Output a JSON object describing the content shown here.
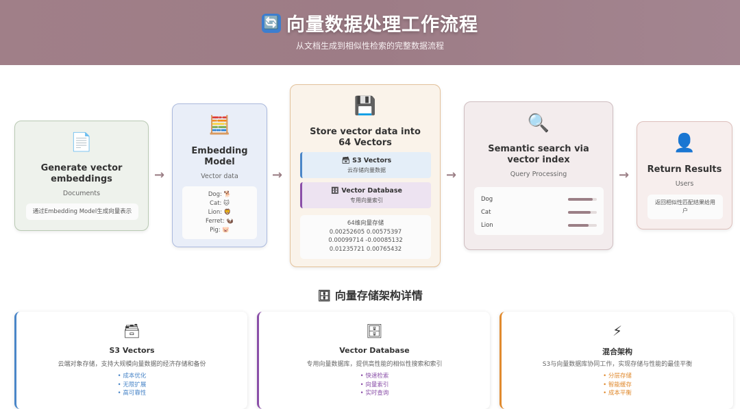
{
  "header": {
    "icon": "🔄",
    "title": "向量数据处理工作流程",
    "subtitle": "从文档生成到相似性检索的完整数据流程"
  },
  "flow": {
    "generate": {
      "icon": "📄",
      "title": "Generate vector embeddings",
      "subtitle": "Documents",
      "note": "通过Embedding Model生成向量表示"
    },
    "embedding": {
      "icon": "🧮",
      "title": "Embedding Model",
      "subtitle": "Vector data",
      "items": [
        "Dog: 🐕",
        "Cat: 🐱",
        "Lion: 🦁",
        "Ferret: 🦦",
        "Pig: 🐷"
      ]
    },
    "store": {
      "icon": "💾",
      "title": "Store vector data into 64 Vectors",
      "s3_title": "🗃 S3 Vectors",
      "s3_sub": "云存储向量数据",
      "db_title": "🗄 Vector Database",
      "db_sub": "专用向量索引",
      "vec_title": "64维向量存储",
      "vec_rows": [
        "0.00252605 0.00575397",
        "0.00099714 -0.00085132",
        "0.01235721 0.00765432"
      ]
    },
    "search": {
      "icon": "🔍",
      "title": "Semantic search via vector index",
      "subtitle": "Query Processing",
      "rows": [
        {
          "label": "Dog",
          "level": 0.85
        },
        {
          "label": "Cat",
          "level": 0.78
        },
        {
          "label": "Lion",
          "level": 0.72
        }
      ]
    },
    "results": {
      "icon": "👤",
      "title": "Return Results",
      "subtitle": "Users",
      "note": "返回相似性匹配结果给用户"
    },
    "arrow": "→"
  },
  "section": {
    "title": "🗄 向量存储架构详情"
  },
  "details": [
    {
      "icon": "🗃",
      "title": "S3 Vectors",
      "desc": "云端对象存储，支持大规模向量数据的经济存储和备份",
      "items": [
        "• 成本优化",
        "• 无限扩展",
        "• 高可靠性"
      ],
      "color": "#4a86c8"
    },
    {
      "icon": "🗄",
      "title": "Vector Database",
      "desc": "专用向量数据库，提供高性能的相似性搜索和索引",
      "items": [
        "• 快速检索",
        "• 向量索引",
        "• 实时查询"
      ],
      "color": "#8a4fa8"
    },
    {
      "icon": "⚡",
      "title": "混合架构",
      "desc": "S3与向量数据库协同工作，实现存储与性能的最佳平衡",
      "items": [
        "• 分层存储",
        "• 智能缓存",
        "• 成本平衡"
      ],
      "color": "#e08a2e"
    }
  ]
}
